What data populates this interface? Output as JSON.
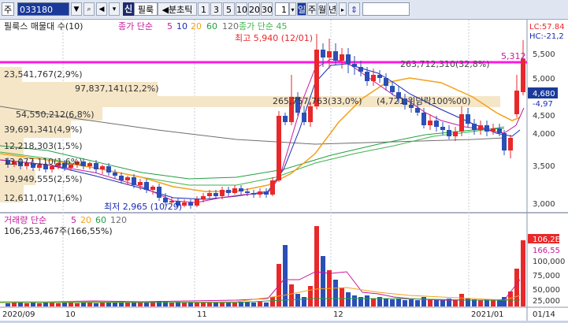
{
  "toolbar": {
    "market_label": "주",
    "code_value": "033180",
    "new_label": "신",
    "stock_name": "필룩",
    "period_label": "분초틱",
    "interval_buttons": [
      "1",
      "3",
      "5",
      "10",
      "20",
      "30"
    ],
    "count_value": "1",
    "period_types": [
      "일",
      "주",
      "월",
      "년"
    ],
    "selected_period": "일"
  },
  "price_panel": {
    "title": "필룩스 매물대 수(10)",
    "ma_legend_prefix": "종가 단순",
    "ma_periods": [
      "5",
      "10",
      "20",
      "60",
      "120"
    ],
    "extra_ma_legend": "종가 단순 45",
    "lc_label": "LC:57.84",
    "hc_label": "HC:-21,2",
    "high_annotation": "최고 5,940 (12/01)",
    "low_annotation": "최저 2,965 (10/29)",
    "last_price_marker": "5,312",
    "current_price_box": "4,680",
    "current_change": "-4,97",
    "horizontal_line_label": "263,712,310(32,8%)",
    "y_ticks": [
      "5,500",
      "5,000",
      "4,500",
      "4,000",
      "3,500",
      "3,000"
    ],
    "volume_profile": [
      {
        "label": "23,541,767(2,9%)"
      },
      {
        "label": "97,837,141(12,2%)"
      },
      {
        "label": "265,757,763(33,0%)"
      },
      {
        "label": "54,550,212(6,8%)"
      },
      {
        "label": "39,691,341(4,9%)"
      },
      {
        "label": "12,218,303(1,5%)"
      },
      {
        "label": "13,077,110(1,6%)"
      },
      {
        "label": "19,949,555(2,5%)"
      },
      {
        "label": "12,611,017(1,6%)"
      }
    ],
    "overlay_label": "(4,721,위당락100%00)"
  },
  "volume_panel": {
    "title": "거래량 단순",
    "ma_periods": [
      "5",
      "20",
      "60",
      "120"
    ],
    "info": "106,253,467주(166,55%)",
    "right_box": "106,2E",
    "y_ticks": [
      "166,55",
      "100,000",
      "75,000",
      "50,000",
      "25,000"
    ]
  },
  "x_axis": {
    "labels": [
      "2020/09",
      "10",
      "11",
      "12",
      "2021/01",
      "01/14"
    ]
  },
  "colors": {
    "up": "#e8282a",
    "down": "#2b4fb6",
    "ma5": "#c8189c",
    "ma10": "#1a2bb3",
    "ma20": "#f2a21c",
    "ma60": "#23a040",
    "ma120": "#6e6e6e",
    "ma45": "#3fb34f",
    "highlight_line": "#ff18e0"
  }
}
